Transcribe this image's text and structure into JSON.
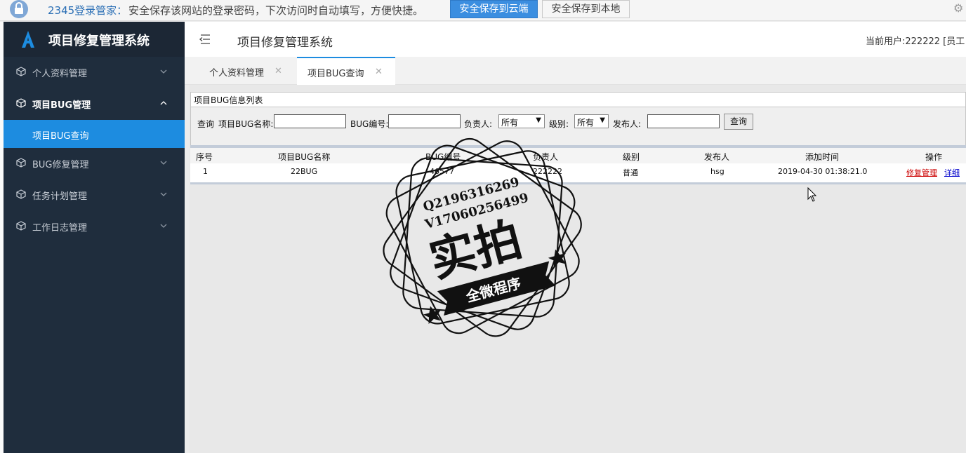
{
  "password_bar": {
    "brand": "2345登录管家：",
    "message": "安全保存该网站的登录密码，下次访问时自动填写，方便快捷。",
    "save_cloud": "安全保存到云端",
    "save_local": "安全保存到本地"
  },
  "sidebar": {
    "logo_text": "项目修复管理系统",
    "items": [
      {
        "label": "个人资料管理",
        "state": "collapsed"
      },
      {
        "label": "项目BUG管理",
        "state": "expanded"
      },
      {
        "label": "BUG修复管理",
        "state": "collapsed"
      },
      {
        "label": "任务计划管理",
        "state": "collapsed"
      },
      {
        "label": "工作日志管理",
        "state": "collapsed"
      }
    ],
    "active_sub_item": "项目BUG查询"
  },
  "header": {
    "title": "项目修复管理系统",
    "current_user": "当前用户:222222 [员工"
  },
  "tabs": [
    {
      "label": "个人资料管理",
      "active": false
    },
    {
      "label": "项目BUG查询",
      "active": true
    }
  ],
  "panel": {
    "title": "项目BUG信息列表"
  },
  "query": {
    "query_label": "查询",
    "name_label": "项目BUG名称:",
    "name_value": "",
    "code_label": "BUG编号:",
    "code_value": "",
    "owner_label": "负责人:",
    "owner_value": "所有",
    "level_label": "级别:",
    "level_value": "所有",
    "publisher_label": "发布人:",
    "publisher_value": "",
    "button": "查询"
  },
  "table": {
    "columns": [
      "序号",
      "项目BUG名称",
      "BUG编号",
      "负责人",
      "级别",
      "发布人",
      "添加时间",
      "操作"
    ],
    "rows": [
      {
        "index": "1",
        "name": "22BUG",
        "code": "46577",
        "owner": "222222",
        "level": "普通",
        "publisher": "hsg",
        "added": "2019-04-30 01:38:21.0",
        "action_repair": "修复管理",
        "action_detail": "详细"
      }
    ]
  },
  "watermark": {
    "line1": "Q2196316269",
    "line2": "V17060256499",
    "main": "实拍",
    "banner": "全微程序"
  },
  "colors": {
    "sidebar_bg": "#1f2d3d",
    "active_blue": "#1d8ce0",
    "link_red": "#cc0000",
    "link_blue": "#0000cc"
  }
}
